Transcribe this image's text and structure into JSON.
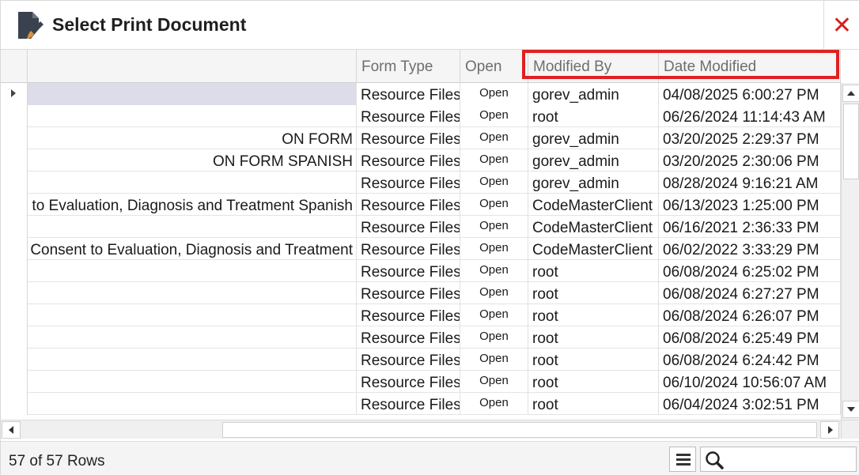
{
  "window": {
    "title": "Select Print Document",
    "close_label": "✕"
  },
  "grid": {
    "columns": [
      {
        "key": "name",
        "label": ""
      },
      {
        "key": "form_type",
        "label": "Form Type"
      },
      {
        "key": "open",
        "label": "Open"
      },
      {
        "key": "modified_by",
        "label": "Modified By"
      },
      {
        "key": "date_modified",
        "label": "Date Modified"
      }
    ],
    "rows": [
      {
        "name": "",
        "form_type": "Resource Files",
        "open": "Open",
        "modified_by": "gorev_admin",
        "date_modified": "04/08/2025 6:00:27 PM",
        "selected": true
      },
      {
        "name": "",
        "form_type": "Resource Files",
        "open": "Open",
        "modified_by": "root",
        "date_modified": "06/26/2024 11:14:43 AM"
      },
      {
        "name": "ON FORM",
        "form_type": "Resource Files",
        "open": "Open",
        "modified_by": "gorev_admin",
        "date_modified": "03/20/2025 2:29:37 PM"
      },
      {
        "name": "ON FORM SPANISH",
        "form_type": "Resource Files",
        "open": "Open",
        "modified_by": "gorev_admin",
        "date_modified": "03/20/2025 2:30:06 PM"
      },
      {
        "name": "",
        "form_type": "Resource Files",
        "open": "Open",
        "modified_by": "gorev_admin",
        "date_modified": "08/28/2024 9:16:21 AM"
      },
      {
        "name": "to Evaluation, Diagnosis and Treatment Spanish",
        "form_type": "Resource Files",
        "open": "Open",
        "modified_by": "CodeMasterClient",
        "date_modified": "06/13/2023 1:25:00 PM"
      },
      {
        "name": "",
        "form_type": "Resource Files",
        "open": "Open",
        "modified_by": "CodeMasterClient",
        "date_modified": "06/16/2021 2:36:33 PM"
      },
      {
        "name": "Consent to Evaluation, Diagnosis and Treatment",
        "form_type": "Resource Files",
        "open": "Open",
        "modified_by": "CodeMasterClient",
        "date_modified": "06/02/2022 3:33:29 PM"
      },
      {
        "name": "",
        "form_type": "Resource Files",
        "open": "Open",
        "modified_by": "root",
        "date_modified": "06/08/2024 6:25:02 PM"
      },
      {
        "name": "",
        "form_type": "Resource Files",
        "open": "Open",
        "modified_by": "root",
        "date_modified": "06/08/2024 6:27:27 PM"
      },
      {
        "name": "",
        "form_type": "Resource Files",
        "open": "Open",
        "modified_by": "root",
        "date_modified": "06/08/2024 6:26:07 PM"
      },
      {
        "name": "",
        "form_type": "Resource Files",
        "open": "Open",
        "modified_by": "root",
        "date_modified": "06/08/2024 6:25:49 PM"
      },
      {
        "name": "",
        "form_type": "Resource Files",
        "open": "Open",
        "modified_by": "root",
        "date_modified": "06/08/2024 6:24:42 PM"
      },
      {
        "name": "",
        "form_type": "Resource Files",
        "open": "Open",
        "modified_by": "root",
        "date_modified": "06/10/2024 10:56:07 AM"
      },
      {
        "name": "",
        "form_type": "Resource Files",
        "open": "Open",
        "modified_by": "root",
        "date_modified": "06/04/2024 3:02:51 PM"
      }
    ]
  },
  "footer": {
    "row_count": "57 of 57 Rows",
    "search_value": ""
  },
  "colors": {
    "close": "#d32020",
    "highlight": "#e02020",
    "selected_row": "#dcdde8",
    "title_icon": "#3a4250",
    "title_icon_accent": "#e0913a"
  },
  "icons": {
    "title": "document-brush-icon",
    "close": "close-icon",
    "menu": "hamburger-menu-icon",
    "search": "magnifier-icon"
  }
}
